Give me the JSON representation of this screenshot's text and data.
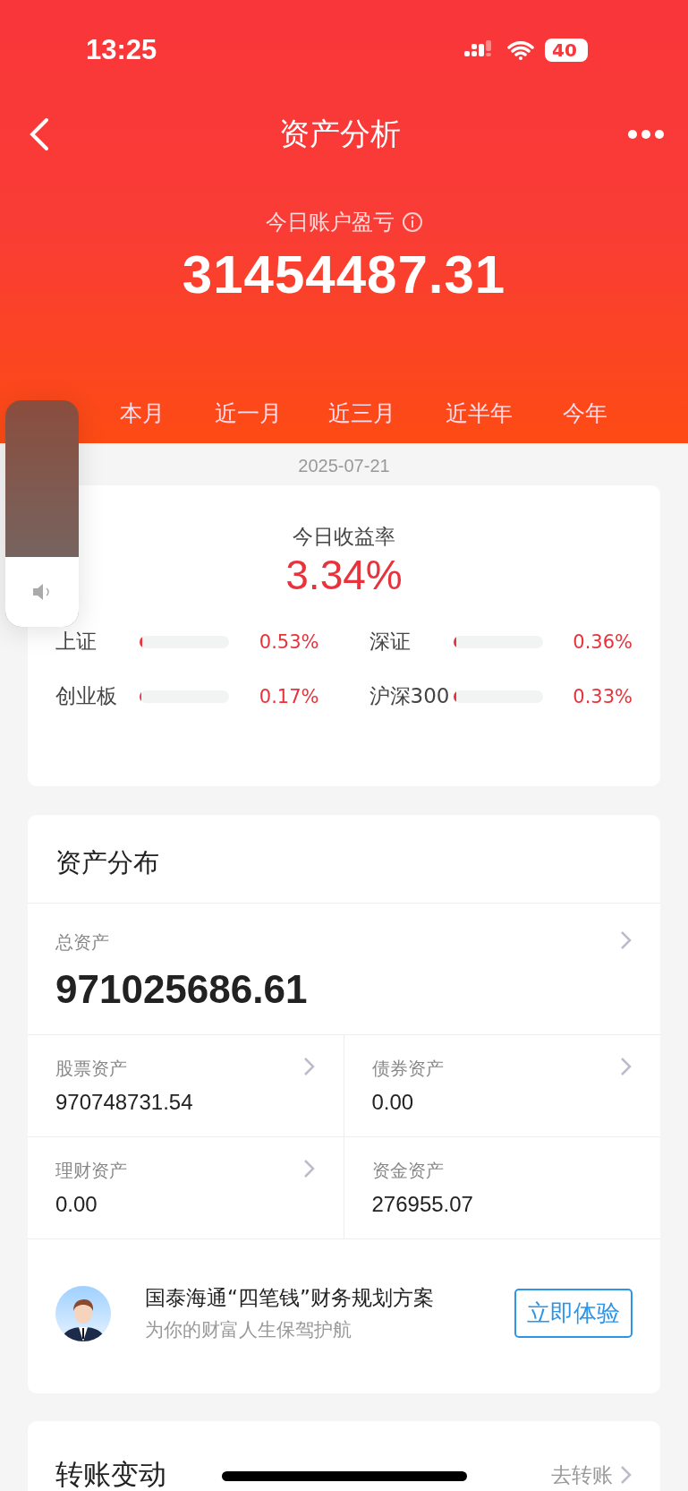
{
  "status_bar": {
    "time": "13:25",
    "battery": "40"
  },
  "nav": {
    "title": "资产分析"
  },
  "summary": {
    "label": "今日账户盈亏",
    "value": "31454487.31"
  },
  "tabs": [
    {
      "label": "本月"
    },
    {
      "label": "近一月"
    },
    {
      "label": "近三月"
    },
    {
      "label": "近半年"
    },
    {
      "label": "今年"
    }
  ],
  "date": "2025-07-21",
  "yield_card": {
    "label": "今日收益率",
    "value": "3.34%",
    "indices": [
      {
        "name": "上证",
        "level": 0.03,
        "reading": "0.53%"
      },
      {
        "name": "深证",
        "level": 0.03,
        "reading": "0.36%"
      },
      {
        "name": "创业板",
        "level": 0.02,
        "reading": "0.17%"
      },
      {
        "name": "沪深300",
        "level": 0.03,
        "reading": "0.33%"
      }
    ]
  },
  "assets": {
    "title": "资产分布",
    "total_label": "总资产",
    "total_value": "971025686.61",
    "items": [
      {
        "label": "股票资产",
        "value": "970748731.54",
        "arrow": true
      },
      {
        "label": "债券资产",
        "value": "0.00",
        "arrow": true
      },
      {
        "label": "理财资产",
        "value": "0.00",
        "arrow": true
      },
      {
        "label": "资金资产",
        "value": "276955.07",
        "arrow": false
      }
    ],
    "promo": {
      "title": "国泰海通“四笔钱”财务规划方案",
      "subtitle": "为你的财富人生保驾护航",
      "button": "立即体验"
    }
  },
  "transfer": {
    "title": "转账变动",
    "link": "去转账"
  },
  "volume": {
    "level": 0.31
  }
}
